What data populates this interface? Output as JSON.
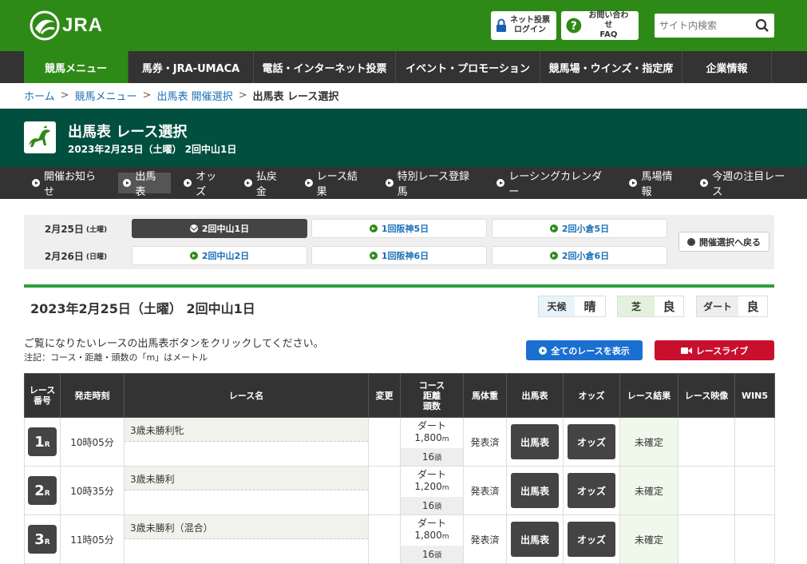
{
  "header": {
    "logo_text": "JRA",
    "net_vote": [
      "ネット投票",
      "ログイン"
    ],
    "faq": [
      "お問い合わせ",
      "FAQ"
    ],
    "search_placeholder": "サイト内検索"
  },
  "gnav": [
    "競馬メニュー",
    "馬券・JRA-UMACA",
    "電話・インターネット投票",
    "イベント・プロモーション",
    "競馬場・ウインズ・指定席",
    "企業情報"
  ],
  "breadcrumb": [
    "ホーム",
    "競馬メニュー",
    "出馬表 開催選択",
    "出馬表 レース選択"
  ],
  "title": {
    "main": "出馬表 レース選択",
    "sub": "2023年2月25日（土曜） 2回中山1日"
  },
  "subnav": [
    "開催お知らせ",
    "出馬表",
    "オッズ",
    "払戻金",
    "レース結果",
    "特別レース登録馬",
    "レーシングカレンダー",
    "馬場情報",
    "今週の注目レース"
  ],
  "schedule": {
    "day1": {
      "date": "2月25日",
      "dow": "(土曜)",
      "meets": [
        "2回中山1日",
        "1回阪神5日",
        "2回小倉5日"
      ]
    },
    "day2": {
      "date": "2月26日",
      "dow": "(日曜)",
      "meets": [
        "2回中山2日",
        "1回阪神6日",
        "2回小倉6日"
      ]
    },
    "back": "開催選択へ戻る"
  },
  "race_title": "2023年2月25日（土曜） 2回中山1日",
  "conditions": {
    "weather_label": "天候",
    "weather": "晴",
    "turf_label": "芝",
    "turf": "良",
    "dirt_label": "ダート",
    "dirt": "良"
  },
  "notice": "ご覧になりたいレースの出馬表ボタンをクリックしてください。",
  "note": "注記：コース・距離・頭数の「m」はメートル",
  "all_races_button": "全てのレースを表示",
  "race_live_button": "レースライブ",
  "table": {
    "headers": {
      "race_no": [
        "レース",
        "番号"
      ],
      "start": "発走時刻",
      "name": "レース名",
      "change": "変更",
      "course": [
        "コース",
        "距離",
        "頭数"
      ],
      "weight": "馬体重",
      "card": "出馬表",
      "odds": "オッズ",
      "result": "レース結果",
      "video": "レース映像",
      "win5": "WIN5"
    },
    "rows": [
      {
        "no": "1",
        "r": "R",
        "time": "10時05分",
        "name": "3歳未勝利牝",
        "surface": "ダート",
        "dist": "1,800",
        "unit": "m",
        "heads": "16",
        "heads_unit": "頭",
        "weight": "発表済",
        "card": "出馬表",
        "odds": "オッズ",
        "result": "未確定"
      },
      {
        "no": "2",
        "r": "R",
        "time": "10時35分",
        "name": "3歳未勝利",
        "surface": "ダート",
        "dist": "1,200",
        "unit": "m",
        "heads": "16",
        "heads_unit": "頭",
        "weight": "発表済",
        "card": "出馬表",
        "odds": "オッズ",
        "result": "未確定"
      },
      {
        "no": "3",
        "r": "R",
        "time": "11時05分",
        "name": "3歳未勝利（混合）",
        "surface": "ダート",
        "dist": "1,800",
        "unit": "m",
        "heads": "16",
        "heads_unit": "頭",
        "weight": "発表済",
        "card": "出馬表",
        "odds": "オッズ",
        "result": "未確定"
      }
    ]
  }
}
